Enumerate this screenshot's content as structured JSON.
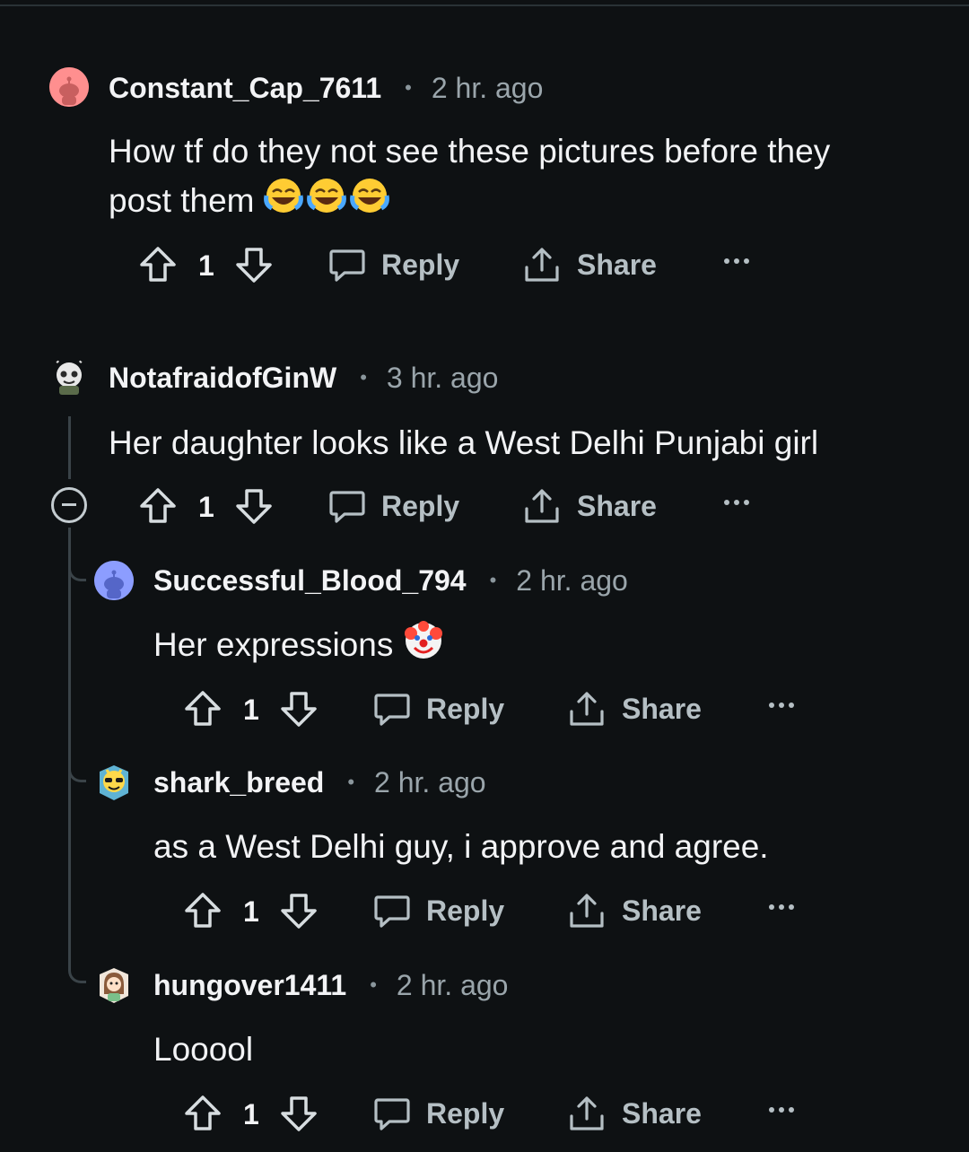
{
  "comments": [
    {
      "username": "Constant_Cap_7611",
      "time": "2 hr. ago",
      "text": "How tf do they not see these pictures before they post them",
      "score": "1",
      "reply_label": "Reply",
      "share_label": "Share",
      "avatar_color": "#ff8a8a"
    },
    {
      "username": "NotafraidofGinW",
      "time": "3 hr. ago",
      "text": "Her daughter looks like a West Delhi Punjabi girl",
      "score": "1",
      "reply_label": "Reply",
      "share_label": "Share",
      "avatar_color": "#d8d8d8"
    },
    {
      "username": "Successful_Blood_794",
      "time": "2 hr. ago",
      "text": "Her expressions",
      "score": "1",
      "reply_label": "Reply",
      "share_label": "Share",
      "avatar_color": "#8a9cff"
    },
    {
      "username": "shark_breed",
      "time": "2 hr. ago",
      "text": "as a West Delhi guy, i approve and agree.",
      "score": "1",
      "reply_label": "Reply",
      "share_label": "Share",
      "avatar_color": "#6fb8d6"
    },
    {
      "username": "hungover1411",
      "time": "2 hr. ago",
      "text": "Looool",
      "score": "1",
      "reply_label": "Reply",
      "share_label": "Share",
      "avatar_color": "#e8d7c8"
    }
  ],
  "icons": {
    "upvote": "arrow-up-icon",
    "downvote": "arrow-down-icon",
    "reply": "speech-bubble-icon",
    "share": "share-icon",
    "more": "ellipsis-icon",
    "collapse": "collapse-minus-icon",
    "emoji_laugh": "face-with-tears-of-joy",
    "emoji_clown": "clown-face"
  },
  "colors": {
    "background": "#0e1113",
    "text": "#f2f3f5",
    "meta": "#9aa5ab",
    "action": "#b5bfc4",
    "thread_line": "#3a4348"
  }
}
